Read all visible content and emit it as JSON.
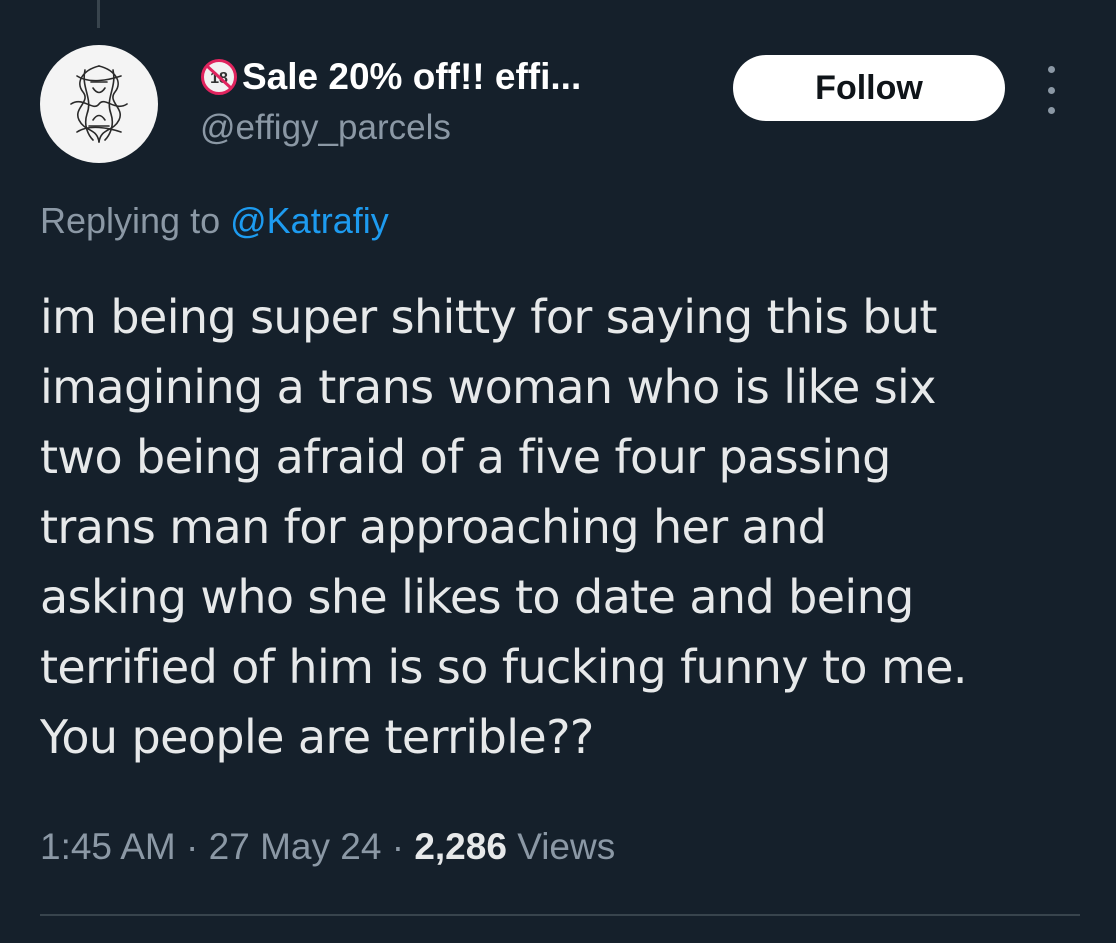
{
  "user": {
    "age_badge": "18",
    "display_name": "Sale 20% off!! effi...",
    "handle": "@effigy_parcels",
    "avatar_icon": "knot-sigil-icon"
  },
  "actions": {
    "follow_label": "Follow",
    "more_icon": "more-vertical-icon"
  },
  "reply": {
    "prefix": "Replying to",
    "mention": "@Katrafiy"
  },
  "tweet": {
    "lines": [
      "im being super shitty for saying this but",
      "imagining a trans woman who is like six",
      "two being afraid of a five four passing",
      "trans man for approaching her and",
      "asking who she likes to date and being",
      "terrified of him is so fucking funny to me.",
      "You people are terrible??"
    ]
  },
  "meta": {
    "time": "1:45 AM",
    "separator": "·",
    "date": "27 May 24",
    "views_count": "2,286",
    "views_label": "Views"
  },
  "colors": {
    "background": "#15202b",
    "accent": "#1d9bf0",
    "muted": "#8b98a5",
    "text": "#e7e9ea"
  }
}
